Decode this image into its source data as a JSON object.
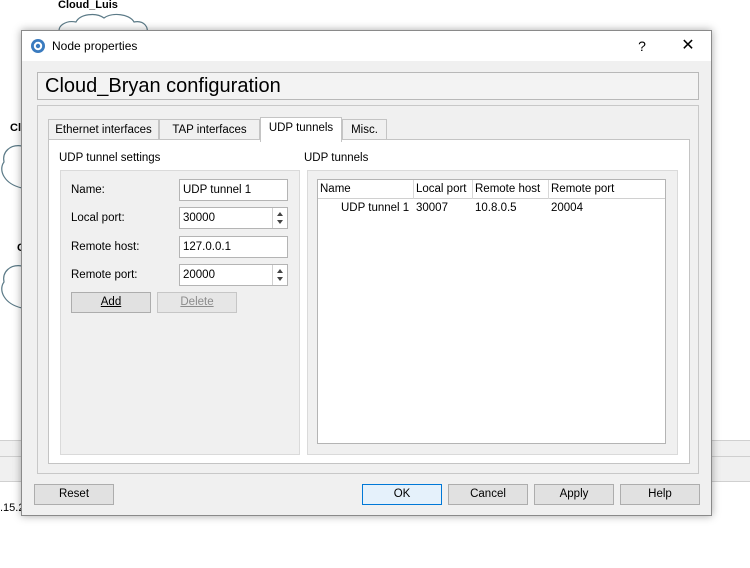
{
  "background": {
    "node_label_top": "Cloud_Luis",
    "node_label_left_partial_1": "Cl",
    "node_label_left_partial_2": "C",
    "status_text_partial": ".15.2"
  },
  "dialog": {
    "title": "Node properties",
    "help_button": "?",
    "close_button": "✕",
    "config_title": "Cloud_Bryan configuration",
    "tabs": [
      {
        "label": "Ethernet interfaces",
        "active": false
      },
      {
        "label": "TAP interfaces",
        "active": false
      },
      {
        "label": "UDP tunnels",
        "active": true
      },
      {
        "label": "Misc.",
        "active": false
      }
    ],
    "settings": {
      "group_title": "UDP tunnel settings",
      "name_label": "Name:",
      "name_value": "UDP tunnel 1",
      "local_port_label": "Local port:",
      "local_port_value": "30000",
      "remote_host_label": "Remote host:",
      "remote_host_value": "127.0.0.1",
      "remote_port_label": "Remote port:",
      "remote_port_value": "20000",
      "add_button": "Add",
      "delete_button": "Delete"
    },
    "tunnels": {
      "group_title": "UDP tunnels",
      "columns": [
        "Name",
        "Local port",
        "Remote host",
        "Remote port"
      ],
      "rows": [
        [
          "UDP tunnel 1",
          "30007",
          "10.8.0.5",
          "20004"
        ]
      ]
    },
    "footer": {
      "reset": "Reset",
      "ok": "OK",
      "cancel": "Cancel",
      "apply": "Apply",
      "help": "Help"
    }
  }
}
